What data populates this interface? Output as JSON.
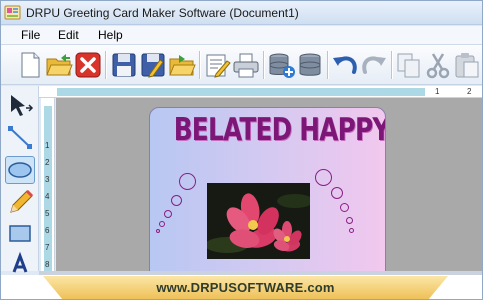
{
  "window": {
    "title": "DRPU Greeting Card Maker Software  (Document1)"
  },
  "menu": {
    "items": [
      "File",
      "Edit",
      "Help"
    ]
  },
  "toolbar": {
    "buttons": [
      "new-document-icon",
      "open-folder-icon",
      "close-icon",
      "save-icon",
      "save-as-icon",
      "export-folder-icon",
      "edit-properties-icon",
      "print-icon",
      "database-add-icon",
      "database-icon",
      "undo-icon",
      "redo-icon",
      "copy-icon",
      "cut-icon",
      "paste-icon"
    ]
  },
  "tools": {
    "items": [
      "select-move-icon",
      "line-tool-icon",
      "ellipse-tool-icon",
      "pencil-tool-icon",
      "rectangle-tool-icon",
      "text-tool-icon"
    ],
    "active": "ellipse-tool-icon"
  },
  "rulers": {
    "top_numbers": [
      "1",
      "2"
    ],
    "left_numbers": [
      "1",
      "2",
      "3",
      "4",
      "5",
      "6",
      "7",
      "8"
    ]
  },
  "card": {
    "title": "BELATED HAPPY BIRTHDAY",
    "background_left": "#b7c8f2",
    "background_right": "#f2c8ee",
    "text_color": "#7c1677"
  },
  "banner": {
    "text": "www.DRPUSOFTWARE.com",
    "color": "#f2c96a"
  }
}
